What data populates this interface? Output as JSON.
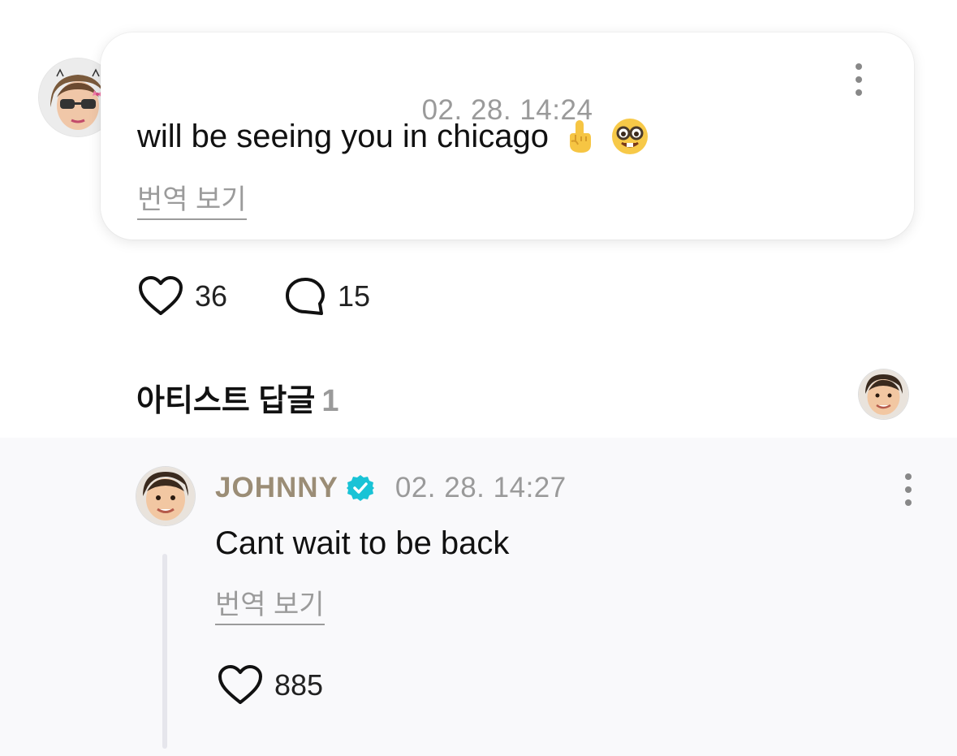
{
  "comment": {
    "timestamp": "02. 28. 14:24",
    "text": "will be seeing you in chicago",
    "emojis": [
      "pointing-up-emoji",
      "nerd-face-emoji"
    ],
    "translate_label": "번역 보기",
    "likes": "36",
    "replies": "15"
  },
  "artist_replies": {
    "title": "아티스트 답글",
    "count": "1"
  },
  "reply": {
    "author": "JOHNNY",
    "verified": true,
    "timestamp": "02. 28. 14:27",
    "text": "Cant wait to be back",
    "translate_label": "번역 보기",
    "likes": "885"
  },
  "colors": {
    "author_name": "#9b8d76",
    "verified_badge": "#19c3d6",
    "muted_text": "#9a9a9a",
    "reply_background": "#f9f9fb"
  }
}
